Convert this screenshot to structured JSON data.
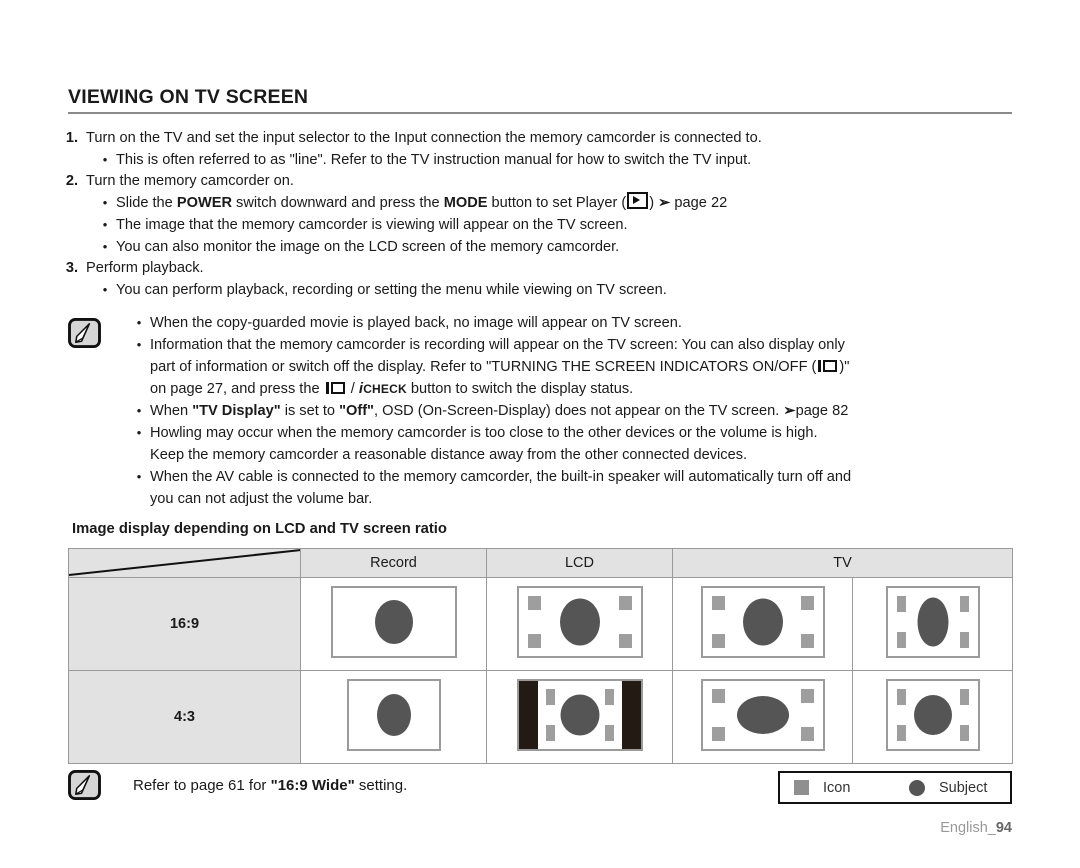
{
  "section": {
    "title": "VIEWING ON TV SCREEN"
  },
  "steps": [
    {
      "num": "1.",
      "text": "Turn on the TV and set the input selector to the Input connection the memory camcorder is connected to.",
      "subs": [
        {
          "bullet": "•",
          "text": "This is often referred to as \"line\". Refer to the TV instruction manual for how to switch the TV input."
        }
      ]
    },
    {
      "num": "2.",
      "text": "Turn the memory camcorder on.",
      "subs": [
        {
          "bullet": "•",
          "pre": "Slide the ",
          "b1": "POWER",
          "mid": " switch downward and press the ",
          "b2": "MODE",
          "post": " button to set Player (",
          "post2": ") ",
          "post3": " page 22"
        },
        {
          "bullet": "•",
          "text": "The image that the memory camcorder is viewing will appear on the TV screen."
        },
        {
          "bullet": "•",
          "text": "You can also monitor the image on the LCD screen of the memory camcorder."
        }
      ]
    },
    {
      "num": "3.",
      "text": "Perform playback.",
      "subs": [
        {
          "bullet": "•",
          "text": "You can perform playback, recording or setting the menu while viewing on TV screen."
        }
      ]
    }
  ],
  "notes": {
    "icon_name": "note-pencil-icon",
    "bullet": "•",
    "lines": [
      {
        "text": "When the copy-guarded movie is played back, no image will appear on TV screen."
      },
      {
        "part1": "Information that the memory camcorder is recording will appear on the TV screen: You can also display only",
        "part2_pre": "part of information or switch off the display. Refer to \"TURNING THE SCREEN INDICATORS ON/OFF (",
        "part2_post": ")\"",
        "part3_pre": "on page 27, and press the ",
        "part3_mid": " / ",
        "part3_icheck_i": "i",
        "part3_icheck_word": "CHECK",
        "part3_post": " button to switch the display status."
      },
      {
        "pre": "When ",
        "b1": "\"TV Display\"",
        "mid": " is set to ",
        "b2": "\"Off\"",
        "post": ", OSD (On-Screen-Display) does not appear on the TV screen. ",
        "ref": "page 82"
      },
      {
        "text": "Howling may occur when the memory camcorder is too close to the other devices or the volume is high.",
        "cont": "Keep the memory camcorder a reasonable distance away from the other connected devices."
      },
      {
        "text": "When the AV cable is connected to the memory camcorder, the built-in speaker will automatically turn off and",
        "cont": "you can not adjust the volume bar."
      }
    ]
  },
  "table": {
    "heading": "Image display depending on LCD and TV screen ratio",
    "headers": [
      "",
      "Record",
      "LCD",
      "TV"
    ],
    "rows": [
      {
        "label": "16:9"
      },
      {
        "label": "4:3"
      }
    ]
  },
  "footer": {
    "icon_name": "note-pencil-icon",
    "pre": "Refer to page 61 for ",
    "bold": "\"16:9 Wide\"",
    "post": " setting."
  },
  "legend": {
    "icon_label": "Icon",
    "subject_label": "Subject"
  },
  "page_label": "English_",
  "page_number": "94",
  "colors": {
    "header_bg": "#e2e2e2",
    "border": "#9a9a9a",
    "subject": "#555555",
    "icon_square": "#9e9e9e",
    "pillar": "#231a14",
    "page_num": "#999999"
  }
}
